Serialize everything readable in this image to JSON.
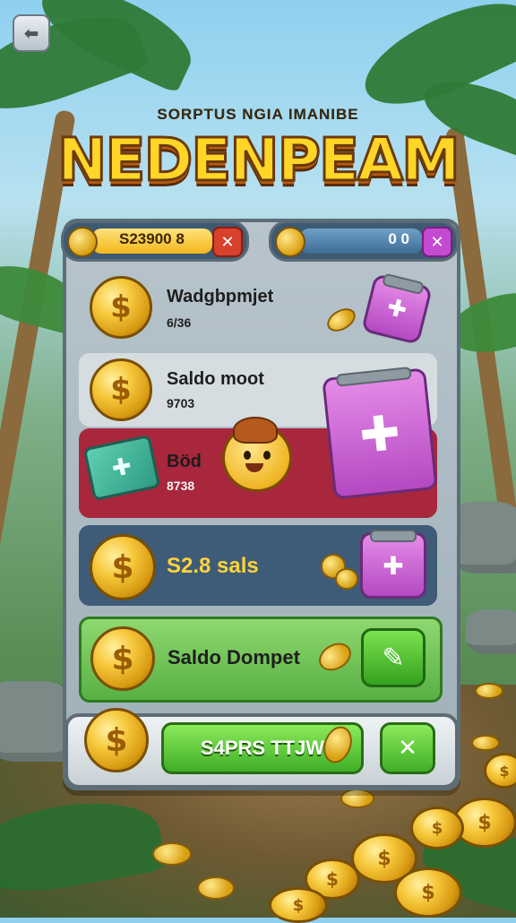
{
  "header": {
    "subtitle": "SORPTUS NGIA IMANIBE",
    "title": "NEDENPEAM"
  },
  "balances": {
    "gold_value": "S23900 8",
    "blue_value": "0 0"
  },
  "rows": [
    {
      "label": "Wadgbpmjet",
      "value": "6/36"
    },
    {
      "label": "Saldo moot",
      "value": "9703"
    },
    {
      "label": "Böd",
      "value": "8738"
    },
    {
      "label": "S2.8 sals"
    },
    {
      "label": "Saldo Dompet"
    }
  ],
  "footer": {
    "claim_label": "S4PRS TTJW"
  },
  "icons": {
    "corner": "back-icon",
    "coin_symbol": "$",
    "plus_symbol": "✚",
    "close_symbol": "✕",
    "check_symbol": "✓",
    "pencil_symbol": "✎"
  },
  "colors": {
    "row_highlight": "#a8273c",
    "row_blue": "#3e5b77",
    "row_green": "#6fc25a",
    "title_fill": "#ffd628"
  }
}
